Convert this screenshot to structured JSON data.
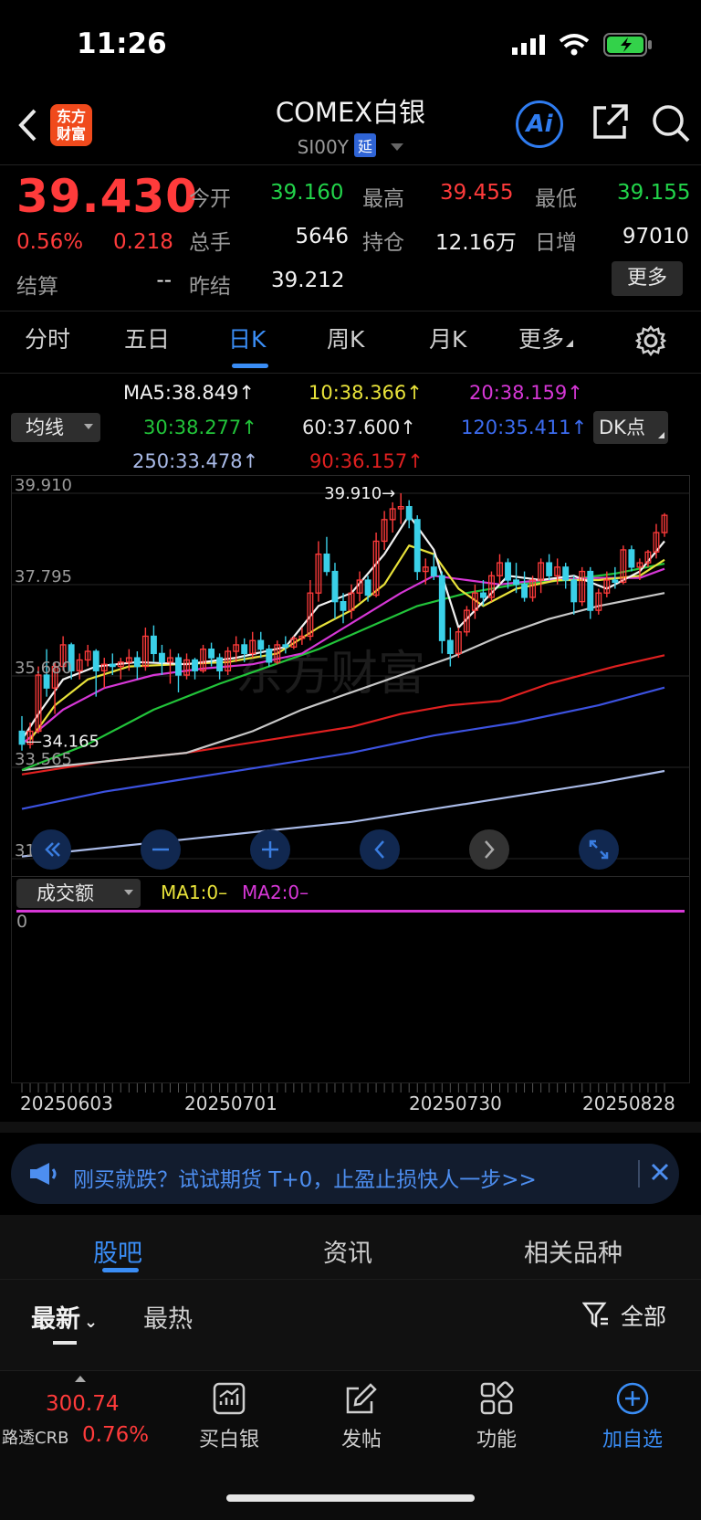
{
  "status": {
    "time": "11:26"
  },
  "header": {
    "title": "COMEX白银",
    "subtitle": "SI00Y",
    "delay_badge": "延",
    "logo_line1": "东方",
    "logo_line2": "财富",
    "ai_label": "Ai"
  },
  "quote": {
    "price": "39.430",
    "change_pct": "0.56%",
    "change": "0.218",
    "open_label": "今开",
    "open": "39.160",
    "high_label": "最高",
    "high": "39.455",
    "low_label": "最低",
    "low": "39.155",
    "volume_label": "总手",
    "volume": "5646",
    "oi_label": "持仓",
    "oi": "12.16万",
    "daily_inc_label": "日增",
    "daily_inc": "97010",
    "settle_label": "结算",
    "settle": "--",
    "prev_settle_label": "昨结",
    "prev_settle": "39.212",
    "more_button": "更多"
  },
  "tabs": [
    {
      "label": "分时"
    },
    {
      "label": "五日"
    },
    {
      "label": "日K"
    },
    {
      "label": "周K"
    },
    {
      "label": "月K"
    },
    {
      "label": "更多"
    }
  ],
  "ma_legend": {
    "selector": "均线",
    "ma5": "MA5:38.849↑",
    "ma10": "10:38.366↑",
    "ma20": "20:38.159↑",
    "ma30": "30:38.277↑",
    "ma60": "60:37.600↑",
    "ma120": "120:35.411↑",
    "ma250": "250:33.478↑",
    "ma90": "90:36.157↑",
    "dk_button": "DK点",
    "colors": {
      "ma5": "#f2f2f2",
      "ma10": "#e8e23a",
      "ma20": "#d637d6",
      "ma30": "#22c43a",
      "ma60": "#c8c8c8",
      "ma120": "#3c52e0",
      "ma250": "#aabbe8",
      "ma90": "#e02020"
    }
  },
  "chart_data": {
    "type": "candlestick",
    "y_axis_ticks": [
      "39.910",
      "37.795",
      "35.680",
      "33.565",
      "31.449"
    ],
    "ylim": [
      31.449,
      39.91
    ],
    "annotations": {
      "high_marker": "39.910",
      "low_marker": "34.165"
    },
    "x_tick_labels": [
      "20250603",
      "20250701",
      "20250730",
      "20250828"
    ],
    "candles": [
      [
        34.4,
        34.75,
        33.95,
        34.1
      ],
      [
        34.1,
        34.6,
        34.0,
        34.4
      ],
      [
        34.4,
        35.9,
        34.35,
        35.7
      ],
      [
        35.7,
        36.3,
        35.2,
        35.4
      ],
      [
        35.4,
        36.0,
        34.8,
        35.9
      ],
      [
        35.9,
        36.6,
        35.8,
        36.4
      ],
      [
        36.4,
        36.45,
        35.6,
        35.8
      ],
      [
        35.8,
        36.2,
        35.6,
        36.05
      ],
      [
        36.05,
        36.4,
        35.9,
        36.25
      ],
      [
        36.25,
        36.3,
        35.2,
        35.8
      ],
      [
        35.8,
        36.1,
        35.4,
        35.95
      ],
      [
        35.95,
        36.2,
        35.7,
        35.9
      ],
      [
        35.9,
        36.1,
        35.6,
        36.0
      ],
      [
        36.0,
        36.3,
        35.8,
        36.1
      ],
      [
        36.1,
        36.25,
        35.6,
        35.9
      ],
      [
        35.9,
        36.8,
        35.8,
        36.6
      ],
      [
        36.6,
        36.85,
        36.0,
        36.2
      ],
      [
        36.2,
        36.4,
        35.7,
        36.0
      ],
      [
        36.0,
        36.3,
        35.5,
        36.1
      ],
      [
        36.1,
        36.2,
        35.3,
        35.7
      ],
      [
        35.7,
        36.2,
        35.6,
        36.05
      ],
      [
        36.05,
        36.1,
        35.6,
        35.8
      ],
      [
        35.8,
        36.4,
        35.75,
        36.3
      ],
      [
        36.3,
        36.45,
        35.9,
        36.1
      ],
      [
        36.1,
        36.2,
        35.6,
        35.8
      ],
      [
        35.8,
        36.35,
        35.7,
        36.25
      ],
      [
        36.25,
        36.6,
        36.0,
        36.4
      ],
      [
        36.4,
        36.55,
        36.0,
        36.2
      ],
      [
        36.2,
        36.7,
        36.1,
        36.5
      ],
      [
        36.5,
        36.7,
        36.1,
        36.3
      ],
      [
        36.3,
        36.4,
        35.9,
        36.0
      ],
      [
        36.0,
        36.5,
        35.95,
        36.4
      ],
      [
        36.4,
        36.6,
        36.2,
        36.35
      ],
      [
        36.35,
        36.6,
        36.3,
        36.55
      ],
      [
        36.55,
        36.8,
        36.4,
        36.6
      ],
      [
        36.6,
        37.9,
        36.5,
        37.6
      ],
      [
        37.6,
        38.8,
        37.4,
        38.5
      ],
      [
        38.5,
        38.9,
        38.0,
        38.1
      ],
      [
        38.1,
        38.3,
        37.0,
        37.4
      ],
      [
        37.4,
        37.6,
        36.9,
        37.2
      ],
      [
        37.2,
        37.8,
        37.0,
        37.6
      ],
      [
        37.6,
        38.1,
        37.4,
        37.9
      ],
      [
        37.9,
        38.0,
        37.4,
        37.55
      ],
      [
        37.55,
        39.0,
        37.5,
        38.8
      ],
      [
        38.8,
        39.5,
        38.6,
        39.3
      ],
      [
        39.3,
        39.7,
        39.0,
        39.55
      ],
      [
        39.55,
        39.91,
        39.2,
        39.6
      ],
      [
        39.6,
        39.75,
        39.1,
        39.3
      ],
      [
        39.3,
        39.4,
        37.9,
        38.1
      ],
      [
        38.1,
        38.4,
        37.8,
        38.2
      ],
      [
        38.2,
        38.5,
        37.9,
        38.0
      ],
      [
        38.0,
        38.1,
        36.2,
        36.5
      ],
      [
        36.5,
        36.8,
        35.9,
        36.2
      ],
      [
        36.2,
        36.8,
        36.1,
        36.7
      ],
      [
        36.7,
        37.3,
        36.6,
        37.2
      ],
      [
        37.2,
        37.8,
        37.0,
        37.6
      ],
      [
        37.6,
        37.9,
        37.3,
        37.5
      ],
      [
        37.5,
        38.1,
        37.4,
        38.0
      ],
      [
        38.0,
        38.5,
        37.8,
        38.3
      ],
      [
        38.3,
        38.4,
        37.7,
        37.9
      ],
      [
        37.9,
        38.3,
        37.6,
        37.8
      ],
      [
        37.8,
        38.1,
        37.4,
        37.5
      ],
      [
        37.5,
        38.0,
        37.4,
        37.9
      ],
      [
        37.9,
        38.4,
        37.6,
        38.3
      ],
      [
        38.3,
        38.5,
        37.9,
        38.0
      ],
      [
        38.0,
        38.4,
        37.8,
        38.2
      ],
      [
        38.2,
        38.3,
        37.7,
        37.9
      ],
      [
        37.9,
        38.0,
        37.1,
        37.4
      ],
      [
        37.4,
        38.2,
        37.3,
        38.1
      ],
      [
        38.1,
        38.2,
        37.0,
        37.2
      ],
      [
        37.2,
        37.7,
        37.1,
        37.6
      ],
      [
        37.6,
        38.1,
        37.5,
        37.9
      ],
      [
        37.9,
        38.2,
        37.7,
        37.85
      ],
      [
        37.85,
        38.7,
        37.8,
        38.6
      ],
      [
        38.6,
        38.7,
        38.1,
        38.2
      ],
      [
        38.2,
        38.4,
        37.9,
        38.3
      ],
      [
        38.3,
        38.6,
        38.2,
        38.55
      ],
      [
        38.55,
        39.2,
        38.4,
        39.0
      ],
      [
        39.0,
        39.45,
        38.9,
        39.4
      ]
    ],
    "ma_series": {
      "ma5": [
        [
          0,
          34.2
        ],
        [
          2,
          34.8
        ],
        [
          5,
          35.6
        ],
        [
          9,
          35.9
        ],
        [
          14,
          36.0
        ],
        [
          20,
          35.95
        ],
        [
          26,
          36.1
        ],
        [
          32,
          36.35
        ],
        [
          36,
          37.3
        ],
        [
          40,
          37.6
        ],
        [
          44,
          38.5
        ],
        [
          47,
          39.4
        ],
        [
          50,
          38.6
        ],
        [
          53,
          36.8
        ],
        [
          56,
          37.4
        ],
        [
          59,
          38.0
        ],
        [
          63,
          37.9
        ],
        [
          67,
          38.0
        ],
        [
          71,
          37.7
        ],
        [
          75,
          38.1
        ],
        [
          78,
          38.8
        ]
      ],
      "ma10": [
        [
          1,
          34.2
        ],
        [
          4,
          35.0
        ],
        [
          8,
          35.6
        ],
        [
          13,
          35.9
        ],
        [
          19,
          35.95
        ],
        [
          25,
          36.0
        ],
        [
          31,
          36.2
        ],
        [
          36,
          36.8
        ],
        [
          40,
          37.2
        ],
        [
          44,
          37.8
        ],
        [
          47,
          38.7
        ],
        [
          50,
          38.5
        ],
        [
          53,
          37.7
        ],
        [
          56,
          37.3
        ],
        [
          60,
          37.7
        ],
        [
          65,
          37.9
        ],
        [
          70,
          37.9
        ],
        [
          75,
          38.0
        ],
        [
          78,
          38.37
        ]
      ],
      "ma20": [
        [
          0,
          34.1
        ],
        [
          5,
          34.9
        ],
        [
          10,
          35.4
        ],
        [
          16,
          35.7
        ],
        [
          22,
          35.85
        ],
        [
          28,
          35.95
        ],
        [
          34,
          36.2
        ],
        [
          40,
          36.9
        ],
        [
          46,
          37.6
        ],
        [
          50,
          38.0
        ],
        [
          54,
          37.9
        ],
        [
          58,
          37.8
        ],
        [
          63,
          37.9
        ],
        [
          70,
          37.95
        ],
        [
          75,
          37.95
        ],
        [
          78,
          38.16
        ]
      ],
      "ma30": [
        [
          0,
          33.5
        ],
        [
          8,
          34.1
        ],
        [
          16,
          34.9
        ],
        [
          24,
          35.5
        ],
        [
          30,
          35.9
        ],
        [
          36,
          36.3
        ],
        [
          42,
          36.8
        ],
        [
          48,
          37.3
        ],
        [
          54,
          37.6
        ],
        [
          60,
          37.8
        ],
        [
          66,
          37.9
        ],
        [
          72,
          38.05
        ],
        [
          78,
          38.28
        ]
      ],
      "ma60": [
        [
          0,
          33.5
        ],
        [
          10,
          33.7
        ],
        [
          20,
          33.9
        ],
        [
          28,
          34.4
        ],
        [
          34,
          34.9
        ],
        [
          40,
          35.3
        ],
        [
          46,
          35.7
        ],
        [
          52,
          36.1
        ],
        [
          58,
          36.6
        ],
        [
          64,
          37.0
        ],
        [
          70,
          37.3
        ],
        [
          78,
          37.6
        ]
      ],
      "ma90": [
        [
          0,
          33.4
        ],
        [
          10,
          33.7
        ],
        [
          20,
          33.9
        ],
        [
          30,
          34.2
        ],
        [
          40,
          34.5
        ],
        [
          46,
          34.8
        ],
        [
          52,
          35.0
        ],
        [
          58,
          35.1
        ],
        [
          64,
          35.5
        ],
        [
          72,
          35.9
        ],
        [
          78,
          36.16
        ]
      ],
      "ma120": [
        [
          0,
          32.6
        ],
        [
          10,
          33.0
        ],
        [
          20,
          33.3
        ],
        [
          30,
          33.6
        ],
        [
          40,
          33.9
        ],
        [
          50,
          34.3
        ],
        [
          60,
          34.6
        ],
        [
          70,
          35.0
        ],
        [
          78,
          35.41
        ]
      ],
      "ma250": [
        [
          0,
          31.5
        ],
        [
          10,
          31.7
        ],
        [
          20,
          31.9
        ],
        [
          30,
          32.1
        ],
        [
          40,
          32.3
        ],
        [
          50,
          32.6
        ],
        [
          60,
          32.9
        ],
        [
          70,
          33.2
        ],
        [
          78,
          33.48
        ]
      ]
    }
  },
  "volume": {
    "selector": "成交额",
    "ma1": "MA1:0–",
    "ma2": "MA2:0–",
    "axis_zero": "0",
    "colors": {
      "ma1": "#e8e23a",
      "ma2": "#d637d6"
    }
  },
  "banner": {
    "text": "刚买就跌？试试期货 T+0，止盈止损快人一步>>"
  },
  "lower_tabs": [
    {
      "label": "股吧"
    },
    {
      "label": "资讯"
    },
    {
      "label": "相关品种"
    }
  ],
  "filter_tabs": {
    "latest": "最新",
    "hot": "最热",
    "filter": "全部"
  },
  "bottom_nav": {
    "index_value": "300.74",
    "index_name": "路透CRB",
    "index_change": "0.76%",
    "buy": "买白银",
    "post": "发帖",
    "func": "功能",
    "add": "加自选"
  },
  "colors": {
    "up": "#ff3b3b",
    "down": "#22d44a",
    "accent": "#3a8df5",
    "candle_down": "#3ad0e8"
  }
}
